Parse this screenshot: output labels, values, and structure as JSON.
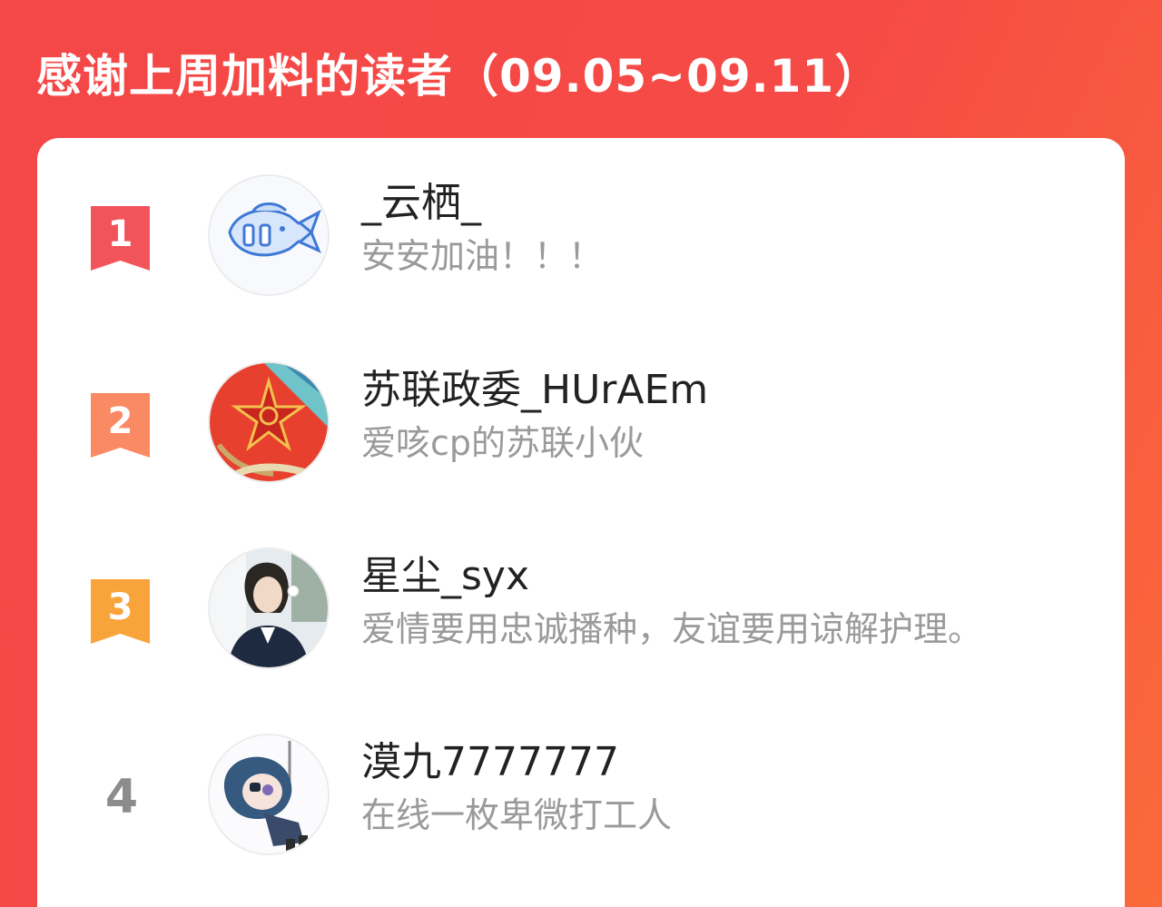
{
  "header": {
    "title": "感谢上周加料的读者（09.05~09.11）"
  },
  "colors": {
    "background_start": "#f44848",
    "background_end": "#fb6a3a",
    "rank1": "#f2545b",
    "rank2": "#f98a63",
    "rank3": "#f9a43a",
    "rank_plain": "#8c8c8c"
  },
  "readers": [
    {
      "rank": "1",
      "name": "_云栖_",
      "bio": "安安加油！！！",
      "avatar_icon": "fish-avatar-icon"
    },
    {
      "rank": "2",
      "name": "苏联政委_HUrAEm",
      "bio": "爱咳cp的苏联小伙",
      "avatar_icon": "soviet-star-avatar-icon"
    },
    {
      "rank": "3",
      "name": "星尘_syx",
      "bio": "爱情要用忠诚播种，友谊要用谅解护理。",
      "avatar_icon": "person-photo-avatar-icon"
    },
    {
      "rank": "4",
      "name": "漠九7777777",
      "bio": "在线一枚卑微打工人",
      "avatar_icon": "anime-character-avatar-icon"
    }
  ]
}
